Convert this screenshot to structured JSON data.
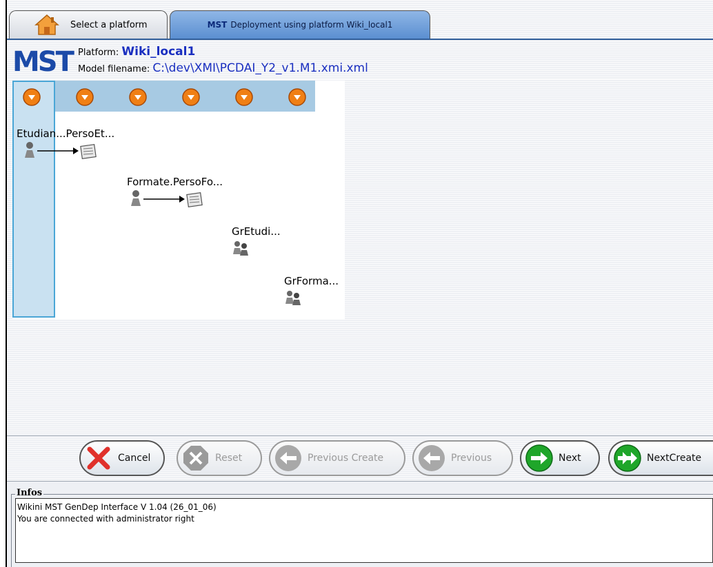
{
  "tabs": [
    {
      "label": "Select a platform",
      "icon": "home-icon"
    },
    {
      "prefix": "MST",
      "label": "Deployment using platform Wiki_local1",
      "active": true
    }
  ],
  "header": {
    "logo_text": "MST",
    "platform_label": "Platform:",
    "platform_value": "Wiki_local1",
    "model_label": "Model filename:",
    "model_value": "C:\\dev\\XMI\\PCDAI_Y2_v1.M1.xmi.xml"
  },
  "diagram": {
    "nodes": [
      {
        "label": "Etudian...PersoEt...",
        "type": "user-to-page"
      },
      {
        "label": "Formate.PersoFo...",
        "type": "user-to-page"
      },
      {
        "label": "GrEtudi...",
        "type": "group"
      },
      {
        "label": "GrForma...",
        "type": "group"
      }
    ]
  },
  "buttons": {
    "cancel": "Cancel",
    "reset": "Reset",
    "previous_create": "Previous Create",
    "previous": "Previous",
    "next": "Next",
    "next_create": "NextCreate"
  },
  "infos": {
    "title": "Infos",
    "lines": [
      "Wikini MST GenDep Interface V 1.04 (26_01_06)",
      "You are connected with administrator right"
    ]
  },
  "colors": {
    "tab_active": "#5b8fd1",
    "lane_header": "#a7cae3",
    "lane_selected_border": "#4aa6d6",
    "link_text": "#1a2fc0",
    "handle_orange": "#f07f14",
    "next_green": "#1fa62a",
    "cancel_red": "#e0312b"
  }
}
